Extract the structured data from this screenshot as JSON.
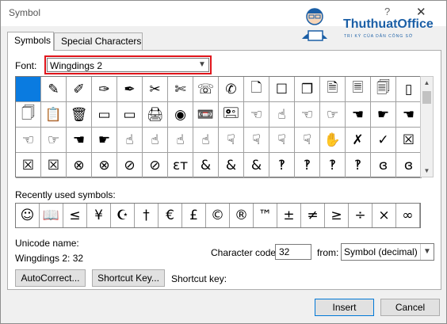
{
  "window": {
    "title": "Symbol",
    "help": "?",
    "close": "✕"
  },
  "watermark": {
    "name": "ThuthuatOffice",
    "tagline": "TRI KÝ CỦA DÂN CÔNG SỞ"
  },
  "tabs": [
    {
      "label": "Symbols",
      "active": true
    },
    {
      "label": "Special Characters",
      "active": false
    }
  ],
  "font": {
    "label": "Font:",
    "value": "Wingdings 2"
  },
  "symbol_grid": [
    [
      "",
      "✎",
      "✐",
      "✑",
      "✒",
      "✂",
      "✄",
      "☏",
      "✆",
      "🗋",
      "☐",
      "❐",
      "🗎",
      "🗏",
      "🗐",
      "▯"
    ],
    [
      "🗍",
      "📋",
      "🗑",
      "▭",
      "▭",
      "🖨",
      "◉",
      "📼",
      "🖭",
      "☜",
      "☝",
      "☜",
      "☞",
      "☚",
      "☛",
      "☚"
    ],
    [
      "☜",
      "☞",
      "☚",
      "☛",
      "☝",
      "☝",
      "☝",
      "☝",
      "☟",
      "☟",
      "☟",
      "☟",
      "✋",
      "✗",
      "✓",
      "☒"
    ],
    [
      "☒",
      "☒",
      "⊗",
      "⊗",
      "⊘",
      "⊘",
      "ɛт",
      "&",
      "&",
      "&",
      "‽",
      "‽",
      "‽",
      "‽",
      "ɞ",
      "ɞ"
    ]
  ],
  "recent": {
    "label": "Recently used symbols:",
    "symbols": [
      "☺",
      "📖",
      "≤",
      "¥",
      "☪",
      "†",
      "€",
      "£",
      "©",
      "®",
      "™",
      "±",
      "≠",
      "≥",
      "÷",
      "×",
      "∞"
    ]
  },
  "unicode": {
    "label": "Unicode name:",
    "value": "Wingdings 2: 32"
  },
  "char_code": {
    "label": "Character code:",
    "value": "32"
  },
  "from": {
    "label": "from:",
    "value": "Symbol (decimal)"
  },
  "buttons": {
    "autocorrect": "AutoCorrect...",
    "shortcut_key": "Shortcut Key...",
    "shortcut_key_label": "Shortcut key:",
    "insert": "Insert",
    "cancel": "Cancel"
  }
}
